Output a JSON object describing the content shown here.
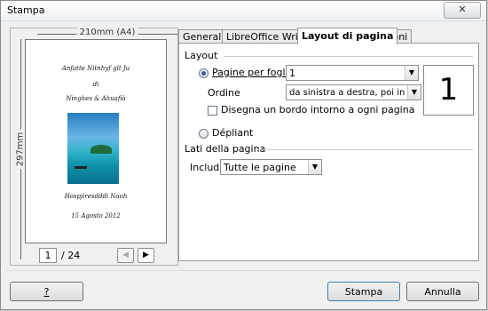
{
  "window": {
    "title": "Stampa",
    "close_glyph": "✕"
  },
  "preview": {
    "width_label": "210mm (A4)",
    "height_label": "297mm",
    "page_lines": [
      "Anfatte Nitnhyf glt Ju",
      "di",
      "Ninghes & Ahuafià",
      "Hospjiresdddi Naoh",
      "15 Agosto 2012"
    ],
    "current_page": "1",
    "total_pages": "/ 24",
    "prev_glyph": "◀",
    "next_glyph": "▶"
  },
  "tabs": [
    "Generale",
    "LibreOffice Writer",
    "Layout di pagina",
    "Opzioni"
  ],
  "active_tab": "Layout di pagina",
  "layout": {
    "section_title": "Layout",
    "pages_per_sheet": {
      "label": "Pagine per foglio",
      "value": "1",
      "preview_value": "1"
    },
    "order": {
      "label": "Ordine",
      "value": "da sinistra a destra, poi in basso"
    },
    "border_label": "Disegna un bordo intorno a ogni pagina",
    "brochure_label": "Dépliant"
  },
  "page_sides": {
    "section_title": "Lati della pagina",
    "include": {
      "label": "Includi",
      "value": "Tutte le pagine"
    }
  },
  "buttons": {
    "help": "?",
    "print": "Stampa",
    "cancel": "Annulla"
  },
  "icons": {
    "close": "close-icon",
    "prev": "arrow-left-icon",
    "next": "arrow-right-icon",
    "dropdown": "chevron-down-icon"
  }
}
